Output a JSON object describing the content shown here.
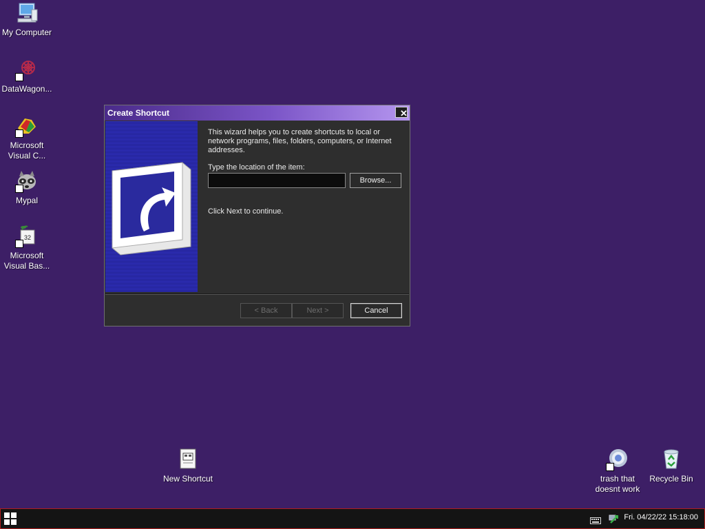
{
  "desktop": {
    "icons": [
      {
        "label": "My Computer",
        "icon": "computer-icon"
      },
      {
        "label": "DataWagon...",
        "icon": "datawagon-icon"
      },
      {
        "label": "Microsoft Visual C...",
        "icon": "visual-c-icon"
      },
      {
        "label": "Mypal",
        "icon": "mypal-raccoon-icon"
      },
      {
        "label": "Microsoft Visual Bas...",
        "icon": "visual-basic-icon"
      },
      {
        "label": "New Shortcut",
        "icon": "shortcut-file-icon"
      },
      {
        "label": "trash that doesnt work",
        "icon": "chrome-like-icon"
      },
      {
        "label": "Recycle Bin",
        "icon": "recycle-bin-icon"
      }
    ],
    "background_color": "#3d1f66"
  },
  "dialog": {
    "title": "Create Shortcut",
    "close_label": "✕",
    "intro": "This wizard helps you to create shortcuts to local or network programs, files, folders, computers, or Internet addresses.",
    "location_label": "Type the location of the item:",
    "location_value": "",
    "browse_label": "Browse...",
    "continue_text": "Click Next to continue.",
    "back_label": "< Back",
    "next_label": "Next >",
    "cancel_label": "Cancel"
  },
  "taskbar": {
    "clock": "Fri. 04/22/22 15:18:00",
    "accent_border": "#b01e1e"
  }
}
